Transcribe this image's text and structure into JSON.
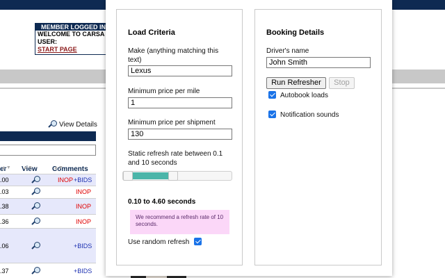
{
  "background": {
    "member_box": {
      "header": "MEMBER LOGGED IN",
      "welcome": "WELCOME TO CARSA",
      "user_label": "USER:",
      "start_link": "START PAGE"
    },
    "view_details": "View Details",
    "table": {
      "columns": [
        "er",
        "View",
        "Comments"
      ],
      "rows": [
        {
          "num": ".00",
          "inop": "INOP",
          "bids": "+BIDS"
        },
        {
          "num": ".03",
          "inop": "INOP",
          "bids": ""
        },
        {
          "num": ".38",
          "inop": "INOP",
          "bids": ""
        },
        {
          "num": ".36",
          "inop": "INOP",
          "bids": ""
        },
        {
          "num": ".06",
          "inop": "",
          "bids": "+BIDS"
        },
        {
          "num": ".37",
          "inop": "",
          "bids": "+BIDS"
        }
      ]
    }
  },
  "load_criteria": {
    "title": "Load Criteria",
    "make_label": "Make (anything matching this text)",
    "make_value": "Lexus",
    "min_price_mile_label": "Minimum price per mile",
    "min_price_mile_value": "1",
    "min_price_shipment_label": "Minimum price per shipment",
    "min_price_shipment_value": "130",
    "refresh_label": "Static refresh rate between 0.1 and 10 seconds",
    "slider": {
      "min": 0.1,
      "max": 10,
      "low": 0.1,
      "high": 4.6
    },
    "range_text": "0.10 to 4.60 seconds",
    "hint": "We recommend a refresh rate of 10 seconds.",
    "random_refresh_label": "Use random refresh",
    "random_refresh_checked": true
  },
  "booking_details": {
    "title": "Booking Details",
    "driver_label": "Driver's name",
    "driver_value": "John Smith",
    "run_button": "Run Refresher",
    "stop_button": "Stop",
    "autobook_label": "Autobook loads",
    "autobook_checked": true,
    "notification_label": "Notification sounds",
    "notification_checked": true
  },
  "colors": {
    "navy": "#0e2a52",
    "slider_fill": "#4bb5a9",
    "hint_bg": "#fbd7f8",
    "checkbox": "#1a73e8",
    "inop": "#e00000",
    "bids": "#1b2fb0"
  }
}
